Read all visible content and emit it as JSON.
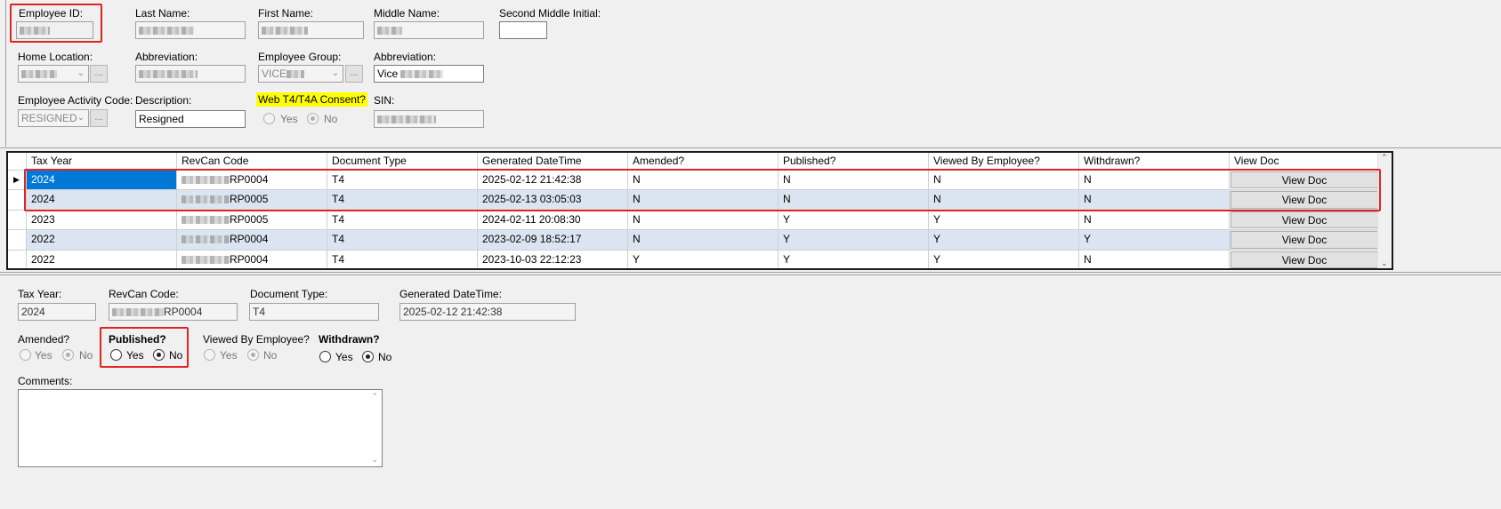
{
  "header": {
    "employee_id": {
      "label": "Employee ID:"
    },
    "last_name": {
      "label": "Last Name:"
    },
    "first_name": {
      "label": "First Name:"
    },
    "middle_name": {
      "label": "Middle Name:"
    },
    "second_middle_initial": {
      "label": "Second Middle Initial:",
      "value": ""
    },
    "home_location": {
      "label": "Home Location:"
    },
    "abbreviation1": {
      "label": "Abbreviation:"
    },
    "employee_group": {
      "label": "Employee Group:",
      "value_prefix": "VICE"
    },
    "abbreviation2": {
      "label": "Abbreviation:",
      "value_prefix": "Vice"
    },
    "activity_code": {
      "label": "Employee Activity Code:",
      "value": "RESIGNED"
    },
    "description": {
      "label": "Description:",
      "value": "Resigned"
    },
    "web_consent": {
      "label": "Web T4/T4A Consent?",
      "yes": "Yes",
      "no": "No"
    },
    "sin": {
      "label": "SIN:"
    },
    "ellipsis": "..."
  },
  "grid": {
    "columns": [
      "Tax Year",
      "RevCan Code",
      "Document Type",
      "Generated DateTime",
      "Amended?",
      "Published?",
      "Viewed By Employee?",
      "Withdrawn?",
      "View Doc"
    ],
    "rows": [
      {
        "tax_year": "2024",
        "revcan_suffix": "RP0004",
        "doc_type": "T4",
        "generated": "2025-02-12 21:42:38",
        "amended": "N",
        "published": "N",
        "viewed": "N",
        "withdrawn": "N",
        "view_doc": "View Doc"
      },
      {
        "tax_year": "2024",
        "revcan_suffix": "RP0005",
        "doc_type": "T4",
        "generated": "2025-02-13 03:05:03",
        "amended": "N",
        "published": "N",
        "viewed": "N",
        "withdrawn": "N",
        "view_doc": "View Doc"
      },
      {
        "tax_year": "2023",
        "revcan_suffix": "RP0005",
        "doc_type": "T4",
        "generated": "2024-02-11 20:08:30",
        "amended": "N",
        "published": "Y",
        "viewed": "Y",
        "withdrawn": "N",
        "view_doc": "View Doc"
      },
      {
        "tax_year": "2022",
        "revcan_suffix": "RP0004",
        "doc_type": "T4",
        "generated": "2023-02-09 18:52:17",
        "amended": "N",
        "published": "Y",
        "viewed": "Y",
        "withdrawn": "Y",
        "view_doc": "View Doc"
      },
      {
        "tax_year": "2022",
        "revcan_suffix": "RP0004",
        "doc_type": "T4",
        "generated": "2023-10-03 22:12:23",
        "amended": "Y",
        "published": "Y",
        "viewed": "Y",
        "withdrawn": "N",
        "view_doc": "View Doc"
      }
    ]
  },
  "detail": {
    "tax_year": {
      "label": "Tax Year:",
      "value": "2024"
    },
    "revcan_code": {
      "label": "RevCan Code:",
      "value_suffix": "RP0004"
    },
    "document_type": {
      "label": "Document Type:",
      "value": "T4"
    },
    "generated": {
      "label": "Generated DateTime:",
      "value": "2025-02-12 21:42:38"
    },
    "amended": {
      "label": "Amended?",
      "yes": "Yes",
      "no": "No"
    },
    "published": {
      "label": "Published?",
      "yes": "Yes",
      "no": "No"
    },
    "viewed": {
      "label": "Viewed By Employee?",
      "yes": "Yes",
      "no": "No"
    },
    "withdrawn": {
      "label": "Withdrawn?",
      "yes": "Yes",
      "no": "No"
    },
    "comments": {
      "label": "Comments:",
      "value": ""
    }
  },
  "colors": {
    "highlight_box": "#e02424",
    "selected_cell": "#0078d7",
    "alt_row": "#dbe5f1",
    "consent_highlight": "#ffff00"
  }
}
